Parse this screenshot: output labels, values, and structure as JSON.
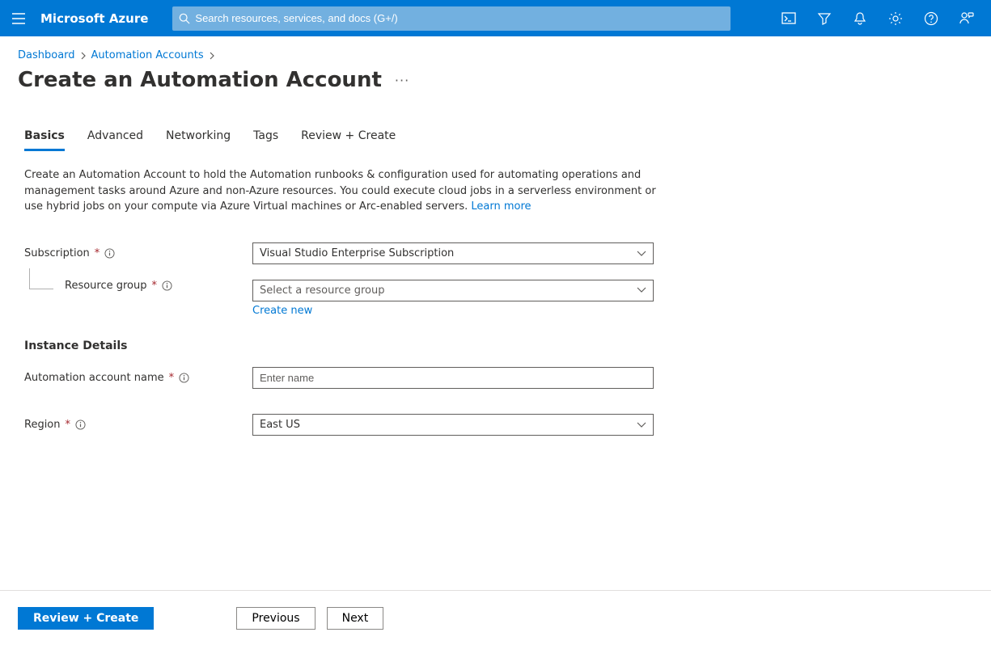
{
  "topbar": {
    "brand": "Microsoft Azure",
    "search_placeholder": "Search resources, services, and docs (G+/)"
  },
  "breadcrumb": {
    "dashboard": "Dashboard",
    "automation_accounts": "Automation Accounts"
  },
  "page": {
    "title": "Create an Automation Account"
  },
  "tabs": {
    "basics": "Basics",
    "advanced": "Advanced",
    "networking": "Networking",
    "tags": "Tags",
    "review": "Review + Create"
  },
  "intro": {
    "text": "Create an Automation Account to hold the Automation runbooks & configuration used for automating operations and management tasks around Azure and non-Azure resources. You could execute cloud jobs in a serverless environment or use hybrid jobs on your compute via Azure Virtual machines or Arc-enabled servers. ",
    "learn_more": "Learn more"
  },
  "form": {
    "subscription": {
      "label": "Subscription",
      "value": "Visual Studio Enterprise Subscription"
    },
    "resource_group": {
      "label": "Resource group",
      "placeholder": "Select a resource group",
      "create_new": "Create new"
    },
    "section_instance": "Instance Details",
    "account_name": {
      "label": "Automation account name",
      "placeholder": "Enter name",
      "value": ""
    },
    "region": {
      "label": "Region",
      "value": "East US"
    }
  },
  "footer": {
    "review": "Review + Create",
    "previous": "Previous",
    "next": "Next"
  }
}
